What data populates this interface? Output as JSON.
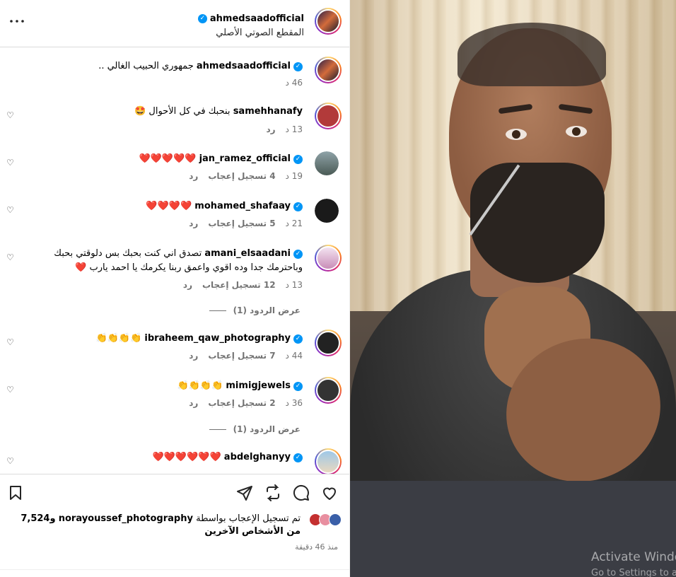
{
  "post_header": {
    "username": "ahmedsaadofficial",
    "subtitle": "المقطع الصوتي الأصلي",
    "more_icon": "more-horizontal-icon"
  },
  "caption": {
    "username": "ahmedsaadofficial",
    "text": "جمهوري الحبيب الغالي ..",
    "time": "46 د"
  },
  "comments": [
    {
      "username": "samehhanafy",
      "verified": false,
      "text": "بنحبك في كل الأحوال 🤩",
      "time": "13 د",
      "likes": "",
      "reply": "رد"
    },
    {
      "username": "jan_ramez_official",
      "verified": true,
      "text": "❤️❤️❤️❤️❤️",
      "time": "19 د",
      "likes": "4 تسجيل إعجاب",
      "reply": "رد"
    },
    {
      "username": "mohamed_shafaay",
      "verified": true,
      "text": "❤️❤️❤️❤️",
      "time": "21 د",
      "likes": "5 تسجيل إعجاب",
      "reply": "رد"
    },
    {
      "username": "amani_elsaadani",
      "verified": true,
      "text": "تصدق اني كنت بحبك بس دلوقتي بحبك وباحترمك جدا وده اقوي واعمق ربنا يكرمك يا احمد يارب ❤️",
      "time": "13 د",
      "likes": "12 تسجيل إعجاب",
      "reply": "رد",
      "view_replies": "عرض الردود (1)"
    },
    {
      "username": "ibraheem_qaw_photography",
      "verified": true,
      "text": "👏👏👏👏",
      "time": "44 د",
      "likes": "7 تسجيل إعجاب",
      "reply": "رد"
    },
    {
      "username": "mimigjewels",
      "verified": true,
      "text": "👏👏👏👏",
      "time": "36 د",
      "likes": "2 تسجيل إعجاب",
      "reply": "رد",
      "view_replies": "عرض الردود (1)"
    },
    {
      "username": "abdelghanyy",
      "verified": true,
      "text": "❤️❤️❤️❤️❤️❤️",
      "time": "",
      "likes": "",
      "reply": ""
    }
  ],
  "footer": {
    "likes_text_prefix": "تم تسجيل الإعجاب بواسطة",
    "liked_by": "norayoussef_photography",
    "likes_text_suffix": "و7,524 من الأشخاص الآخرين",
    "time_ago": "منذ 46 دقيقة"
  },
  "watermark": {
    "line1": "Activate Windows",
    "line2": "Go to Settings to activate Windows."
  },
  "colors": {
    "verified": "#0095f6",
    "meta_text": "#737373",
    "divider": "#dbdbdb"
  }
}
